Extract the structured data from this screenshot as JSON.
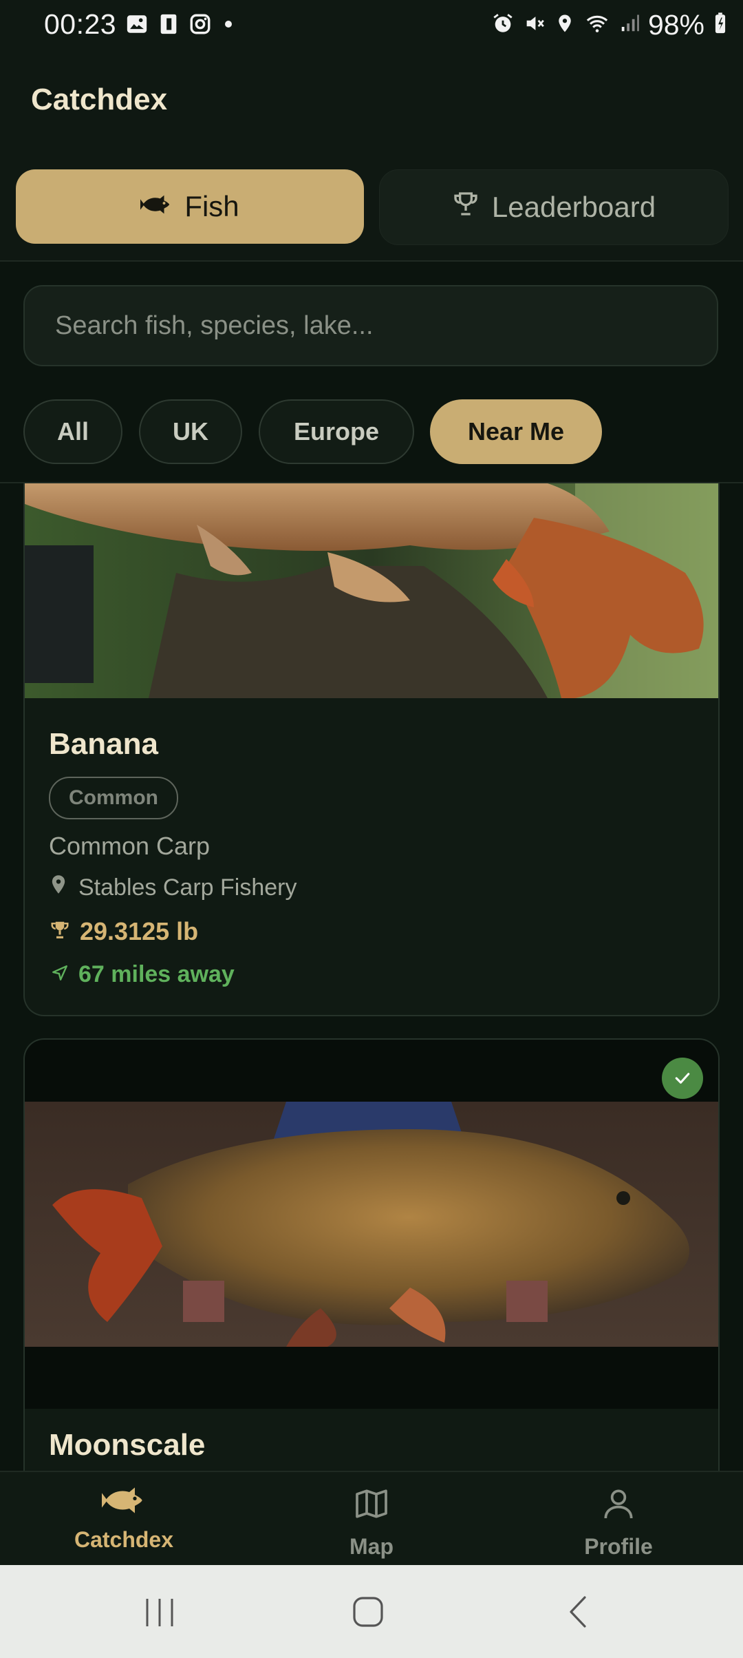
{
  "status_bar": {
    "time": "00:23",
    "battery": "98%",
    "left_icons": [
      "image-icon",
      "sim-icon",
      "instagram-icon",
      "dot-icon"
    ],
    "right_icons": [
      "alarm-icon",
      "mute-icon",
      "location-icon",
      "wifi-icon",
      "signal-icon",
      "battery-icon"
    ]
  },
  "header": {
    "title": "Catchdex",
    "tabs": [
      {
        "label": "Fish",
        "icon": "fish-icon",
        "active": true
      },
      {
        "label": "Leaderboard",
        "icon": "trophy-icon",
        "active": false
      }
    ]
  },
  "search": {
    "placeholder": "Search fish, species, lake..."
  },
  "filters": [
    {
      "label": "All",
      "active": false
    },
    {
      "label": "UK",
      "active": false
    },
    {
      "label": "Europe",
      "active": false
    },
    {
      "label": "Near Me",
      "active": true
    }
  ],
  "fish_cards": [
    {
      "name": "Banana",
      "badge": "Common",
      "species": "Common Carp",
      "lake": "Stables Carp Fishery",
      "weight": "29.3125 lb",
      "distance": "67 miles away",
      "caught": false
    },
    {
      "name": "Moonscale",
      "caught": true
    }
  ],
  "bottom_nav": [
    {
      "label": "Catchdex",
      "icon": "fish-icon",
      "active": true
    },
    {
      "label": "Map",
      "icon": "map-icon",
      "active": false
    },
    {
      "label": "Profile",
      "icon": "user-icon",
      "active": false
    }
  ],
  "colors": {
    "background": "#0b140e",
    "accent": "#c9ad73",
    "weight": "#d6b574",
    "distance": "#5fb15c",
    "caught_check": "#4b8a43"
  }
}
